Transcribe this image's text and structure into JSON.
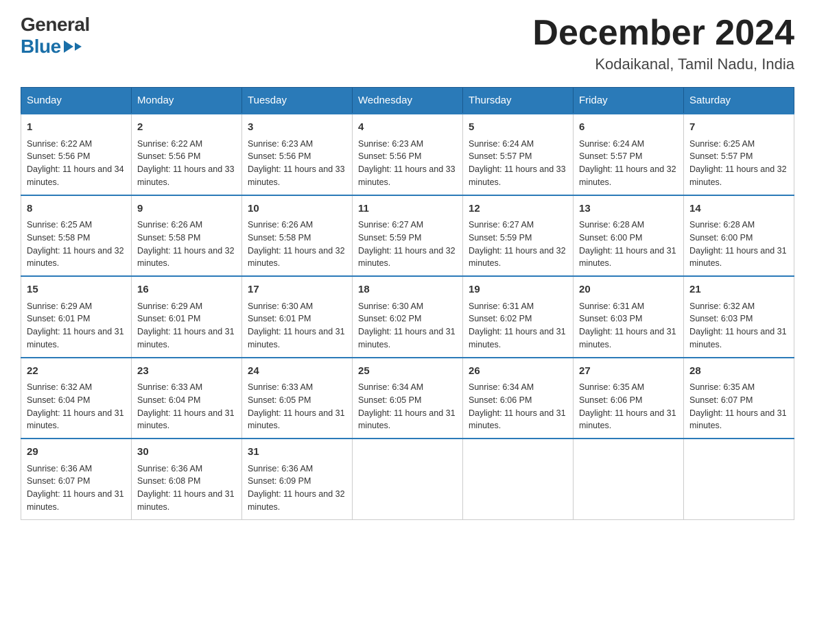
{
  "logo": {
    "general": "General",
    "blue": "Blue"
  },
  "title": {
    "month_year": "December 2024",
    "location": "Kodaikanal, Tamil Nadu, India"
  },
  "headers": [
    "Sunday",
    "Monday",
    "Tuesday",
    "Wednesday",
    "Thursday",
    "Friday",
    "Saturday"
  ],
  "weeks": [
    [
      {
        "day": "1",
        "sunrise": "6:22 AM",
        "sunset": "5:56 PM",
        "daylight": "11 hours and 34 minutes."
      },
      {
        "day": "2",
        "sunrise": "6:22 AM",
        "sunset": "5:56 PM",
        "daylight": "11 hours and 33 minutes."
      },
      {
        "day": "3",
        "sunrise": "6:23 AM",
        "sunset": "5:56 PM",
        "daylight": "11 hours and 33 minutes."
      },
      {
        "day": "4",
        "sunrise": "6:23 AM",
        "sunset": "5:56 PM",
        "daylight": "11 hours and 33 minutes."
      },
      {
        "day": "5",
        "sunrise": "6:24 AM",
        "sunset": "5:57 PM",
        "daylight": "11 hours and 33 minutes."
      },
      {
        "day": "6",
        "sunrise": "6:24 AM",
        "sunset": "5:57 PM",
        "daylight": "11 hours and 32 minutes."
      },
      {
        "day": "7",
        "sunrise": "6:25 AM",
        "sunset": "5:57 PM",
        "daylight": "11 hours and 32 minutes."
      }
    ],
    [
      {
        "day": "8",
        "sunrise": "6:25 AM",
        "sunset": "5:58 PM",
        "daylight": "11 hours and 32 minutes."
      },
      {
        "day": "9",
        "sunrise": "6:26 AM",
        "sunset": "5:58 PM",
        "daylight": "11 hours and 32 minutes."
      },
      {
        "day": "10",
        "sunrise": "6:26 AM",
        "sunset": "5:58 PM",
        "daylight": "11 hours and 32 minutes."
      },
      {
        "day": "11",
        "sunrise": "6:27 AM",
        "sunset": "5:59 PM",
        "daylight": "11 hours and 32 minutes."
      },
      {
        "day": "12",
        "sunrise": "6:27 AM",
        "sunset": "5:59 PM",
        "daylight": "11 hours and 32 minutes."
      },
      {
        "day": "13",
        "sunrise": "6:28 AM",
        "sunset": "6:00 PM",
        "daylight": "11 hours and 31 minutes."
      },
      {
        "day": "14",
        "sunrise": "6:28 AM",
        "sunset": "6:00 PM",
        "daylight": "11 hours and 31 minutes."
      }
    ],
    [
      {
        "day": "15",
        "sunrise": "6:29 AM",
        "sunset": "6:01 PM",
        "daylight": "11 hours and 31 minutes."
      },
      {
        "day": "16",
        "sunrise": "6:29 AM",
        "sunset": "6:01 PM",
        "daylight": "11 hours and 31 minutes."
      },
      {
        "day": "17",
        "sunrise": "6:30 AM",
        "sunset": "6:01 PM",
        "daylight": "11 hours and 31 minutes."
      },
      {
        "day": "18",
        "sunrise": "6:30 AM",
        "sunset": "6:02 PM",
        "daylight": "11 hours and 31 minutes."
      },
      {
        "day": "19",
        "sunrise": "6:31 AM",
        "sunset": "6:02 PM",
        "daylight": "11 hours and 31 minutes."
      },
      {
        "day": "20",
        "sunrise": "6:31 AM",
        "sunset": "6:03 PM",
        "daylight": "11 hours and 31 minutes."
      },
      {
        "day": "21",
        "sunrise": "6:32 AM",
        "sunset": "6:03 PM",
        "daylight": "11 hours and 31 minutes."
      }
    ],
    [
      {
        "day": "22",
        "sunrise": "6:32 AM",
        "sunset": "6:04 PM",
        "daylight": "11 hours and 31 minutes."
      },
      {
        "day": "23",
        "sunrise": "6:33 AM",
        "sunset": "6:04 PM",
        "daylight": "11 hours and 31 minutes."
      },
      {
        "day": "24",
        "sunrise": "6:33 AM",
        "sunset": "6:05 PM",
        "daylight": "11 hours and 31 minutes."
      },
      {
        "day": "25",
        "sunrise": "6:34 AM",
        "sunset": "6:05 PM",
        "daylight": "11 hours and 31 minutes."
      },
      {
        "day": "26",
        "sunrise": "6:34 AM",
        "sunset": "6:06 PM",
        "daylight": "11 hours and 31 minutes."
      },
      {
        "day": "27",
        "sunrise": "6:35 AM",
        "sunset": "6:06 PM",
        "daylight": "11 hours and 31 minutes."
      },
      {
        "day": "28",
        "sunrise": "6:35 AM",
        "sunset": "6:07 PM",
        "daylight": "11 hours and 31 minutes."
      }
    ],
    [
      {
        "day": "29",
        "sunrise": "6:36 AM",
        "sunset": "6:07 PM",
        "daylight": "11 hours and 31 minutes."
      },
      {
        "day": "30",
        "sunrise": "6:36 AM",
        "sunset": "6:08 PM",
        "daylight": "11 hours and 31 minutes."
      },
      {
        "day": "31",
        "sunrise": "6:36 AM",
        "sunset": "6:09 PM",
        "daylight": "11 hours and 32 minutes."
      },
      null,
      null,
      null,
      null
    ]
  ],
  "labels": {
    "sunrise": "Sunrise:",
    "sunset": "Sunset:",
    "daylight": "Daylight:"
  }
}
